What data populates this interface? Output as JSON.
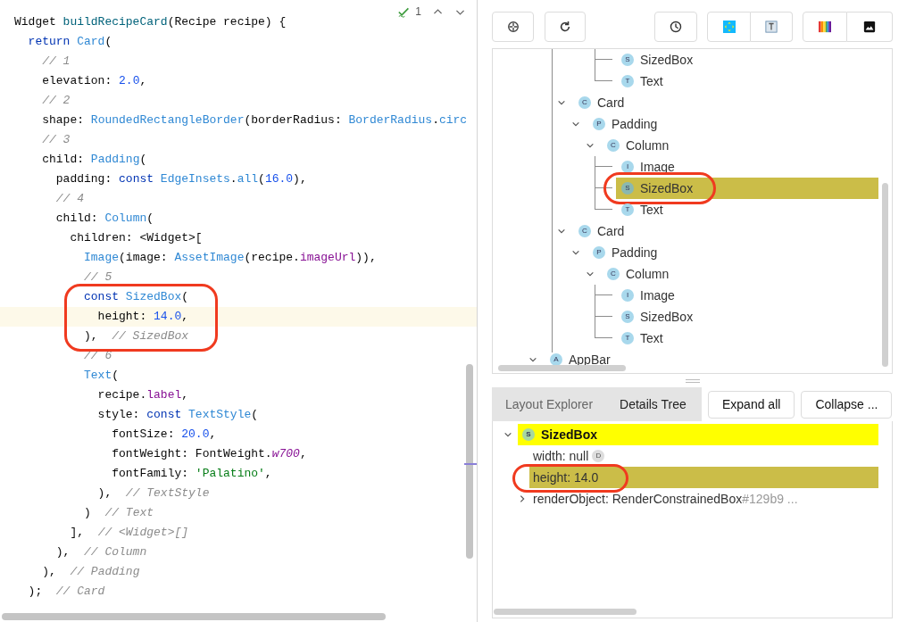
{
  "editor": {
    "inspection_count": "1",
    "lines": [
      {
        "current": false,
        "circled": false,
        "tokens": [
          {
            "text": "Widget ",
            "kind": "plain"
          },
          {
            "text": "buildRecipeCard",
            "kind": "function"
          },
          {
            "text": "(Recipe recipe) {",
            "kind": "plain"
          }
        ]
      },
      {
        "current": false,
        "circled": false,
        "tokens": [
          {
            "text": "  return ",
            "kind": "keyword"
          },
          {
            "text": "Card",
            "kind": "class"
          },
          {
            "text": "(",
            "kind": "plain"
          }
        ]
      },
      {
        "current": false,
        "circled": false,
        "tokens": [
          {
            "text": "    // 1",
            "kind": "comment"
          }
        ]
      },
      {
        "current": false,
        "circled": false,
        "tokens": [
          {
            "text": "    elevation: ",
            "kind": "plain"
          },
          {
            "text": "2.0",
            "kind": "number"
          },
          {
            "text": ",",
            "kind": "plain"
          }
        ]
      },
      {
        "current": false,
        "circled": false,
        "tokens": [
          {
            "text": "    // 2",
            "kind": "comment"
          }
        ]
      },
      {
        "current": false,
        "circled": false,
        "tokens": [
          {
            "text": "    shape: ",
            "kind": "plain"
          },
          {
            "text": "RoundedRectangleBorder",
            "kind": "class"
          },
          {
            "text": "(borderRadius: ",
            "kind": "plain"
          },
          {
            "text": "BorderRadius",
            "kind": "class"
          },
          {
            "text": ".",
            "kind": "plain"
          },
          {
            "text": "circ",
            "kind": "class"
          }
        ]
      },
      {
        "current": false,
        "circled": false,
        "tokens": [
          {
            "text": "    // 3",
            "kind": "comment"
          }
        ]
      },
      {
        "current": false,
        "circled": false,
        "tokens": [
          {
            "text": "    child: ",
            "kind": "plain"
          },
          {
            "text": "Padding",
            "kind": "class"
          },
          {
            "text": "(",
            "kind": "plain"
          }
        ]
      },
      {
        "current": false,
        "circled": false,
        "tokens": [
          {
            "text": "      padding: ",
            "kind": "plain"
          },
          {
            "text": "const ",
            "kind": "keyword"
          },
          {
            "text": "EdgeInsets",
            "kind": "class"
          },
          {
            "text": ".",
            "kind": "plain"
          },
          {
            "text": "all",
            "kind": "class"
          },
          {
            "text": "(",
            "kind": "plain"
          },
          {
            "text": "16.0",
            "kind": "number"
          },
          {
            "text": "),",
            "kind": "plain"
          }
        ]
      },
      {
        "current": false,
        "circled": false,
        "tokens": [
          {
            "text": "      // 4",
            "kind": "comment"
          }
        ]
      },
      {
        "current": false,
        "circled": false,
        "tokens": [
          {
            "text": "      child: ",
            "kind": "plain"
          },
          {
            "text": "Column",
            "kind": "class"
          },
          {
            "text": "(",
            "kind": "plain"
          }
        ]
      },
      {
        "current": false,
        "circled": false,
        "tokens": [
          {
            "text": "        children: <Widget>[",
            "kind": "plain"
          }
        ]
      },
      {
        "current": false,
        "circled": false,
        "tokens": [
          {
            "text": "          Image",
            "kind": "class"
          },
          {
            "text": "(image: ",
            "kind": "plain"
          },
          {
            "text": "AssetImage",
            "kind": "class"
          },
          {
            "text": "(recipe.",
            "kind": "plain"
          },
          {
            "text": "imageUrl",
            "kind": "field"
          },
          {
            "text": ")),",
            "kind": "plain"
          }
        ]
      },
      {
        "current": false,
        "circled": false,
        "tokens": [
          {
            "text": "          // 5",
            "kind": "comment"
          }
        ]
      },
      {
        "current": false,
        "circled": true,
        "tokens": [
          {
            "text": "          const ",
            "kind": "keyword"
          },
          {
            "text": "SizedBox",
            "kind": "class"
          },
          {
            "text": "(",
            "kind": "plain"
          }
        ]
      },
      {
        "current": true,
        "circled": true,
        "tokens": [
          {
            "text": "            height: ",
            "kind": "plain"
          },
          {
            "text": "14.0",
            "kind": "number"
          },
          {
            "text": ",",
            "kind": "plain"
          }
        ]
      },
      {
        "current": false,
        "circled": true,
        "tokens": [
          {
            "text": "          ),  ",
            "kind": "plain"
          },
          {
            "text": "// SizedBox",
            "kind": "comment"
          }
        ]
      },
      {
        "current": false,
        "circled": false,
        "tokens": [
          {
            "text": "          // 6",
            "kind": "comment"
          }
        ]
      },
      {
        "current": false,
        "circled": false,
        "tokens": [
          {
            "text": "          Text",
            "kind": "class"
          },
          {
            "text": "(",
            "kind": "plain"
          }
        ]
      },
      {
        "current": false,
        "circled": false,
        "tokens": [
          {
            "text": "            recipe.",
            "kind": "plain"
          },
          {
            "text": "label",
            "kind": "field"
          },
          {
            "text": ",",
            "kind": "plain"
          }
        ]
      },
      {
        "current": false,
        "circled": false,
        "tokens": [
          {
            "text": "            style: ",
            "kind": "plain"
          },
          {
            "text": "const ",
            "kind": "keyword"
          },
          {
            "text": "TextStyle",
            "kind": "class"
          },
          {
            "text": "(",
            "kind": "plain"
          }
        ]
      },
      {
        "current": false,
        "circled": false,
        "tokens": [
          {
            "text": "              fontSize: ",
            "kind": "plain"
          },
          {
            "text": "20.0",
            "kind": "number"
          },
          {
            "text": ",",
            "kind": "plain"
          }
        ]
      },
      {
        "current": false,
        "circled": false,
        "tokens": [
          {
            "text": "              fontWeight: FontWeight.",
            "kind": "plain"
          },
          {
            "text": "w700",
            "kind": "constant"
          },
          {
            "text": ",",
            "kind": "plain"
          }
        ]
      },
      {
        "current": false,
        "circled": false,
        "tokens": [
          {
            "text": "              fontFamily: ",
            "kind": "plain"
          },
          {
            "text": "'Palatino'",
            "kind": "string"
          },
          {
            "text": ",",
            "kind": "plain"
          }
        ]
      },
      {
        "current": false,
        "circled": false,
        "tokens": [
          {
            "text": "            ),  ",
            "kind": "plain"
          },
          {
            "text": "// TextStyle",
            "kind": "comment"
          }
        ]
      },
      {
        "current": false,
        "circled": false,
        "tokens": [
          {
            "text": "          )  ",
            "kind": "plain"
          },
          {
            "text": "// Text",
            "kind": "comment"
          }
        ]
      },
      {
        "current": false,
        "circled": false,
        "tokens": [
          {
            "text": "        ],  ",
            "kind": "plain"
          },
          {
            "text": "// <Widget>[]",
            "kind": "comment"
          }
        ]
      },
      {
        "current": false,
        "circled": false,
        "tokens": [
          {
            "text": "      ),  ",
            "kind": "plain"
          },
          {
            "text": "// Column",
            "kind": "comment"
          }
        ]
      },
      {
        "current": false,
        "circled": false,
        "tokens": [
          {
            "text": "    ),  ",
            "kind": "plain"
          },
          {
            "text": "// Padding",
            "kind": "comment"
          }
        ]
      },
      {
        "current": false,
        "circled": false,
        "tokens": [
          {
            "text": "  );  ",
            "kind": "plain"
          },
          {
            "text": "// Card",
            "kind": "comment"
          }
        ]
      }
    ]
  },
  "widget_tree": {
    "items": [
      {
        "children": [
          {
            "children": [
              {
                "children": [
                  {
                    "children": [
                      {
                        "children": [
                          {
                            "badge": "S",
                            "label": "SizedBox",
                            "selected": false,
                            "circled": false
                          },
                          {
                            "badge": "T",
                            "label": "Text",
                            "selected": false,
                            "circled": false
                          }
                        ]
                      }
                    ]
                  }
                ]
              },
              {
                "badge": "C",
                "label": "Card",
                "expanded": true,
                "selected": false,
                "circled": false,
                "children": [
                  {
                    "badge": "P",
                    "label": "Padding",
                    "expanded": true,
                    "selected": false,
                    "circled": false,
                    "children": [
                      {
                        "badge": "C",
                        "label": "Column",
                        "expanded": true,
                        "selected": false,
                        "circled": false,
                        "children": [
                          {
                            "badge": "I",
                            "label": "Image",
                            "selected": false,
                            "circled": false
                          },
                          {
                            "badge": "S",
                            "label": "SizedBox",
                            "selected": true,
                            "circled": true
                          },
                          {
                            "badge": "T",
                            "label": "Text",
                            "selected": false,
                            "circled": false
                          }
                        ]
                      }
                    ]
                  }
                ]
              },
              {
                "badge": "C",
                "label": "Card",
                "expanded": true,
                "selected": false,
                "circled": false,
                "children": [
                  {
                    "badge": "P",
                    "label": "Padding",
                    "expanded": true,
                    "selected": false,
                    "circled": false,
                    "children": [
                      {
                        "badge": "C",
                        "label": "Column",
                        "expanded": true,
                        "selected": false,
                        "circled": false,
                        "children": [
                          {
                            "badge": "I",
                            "label": "Image",
                            "selected": false,
                            "circled": false
                          },
                          {
                            "badge": "S",
                            "label": "SizedBox",
                            "selected": false,
                            "circled": false
                          },
                          {
                            "badge": "T",
                            "label": "Text",
                            "selected": false,
                            "circled": false
                          }
                        ]
                      }
                    ]
                  }
                ]
              }
            ]
          }
        ]
      },
      {
        "badge": "A",
        "label": "AppBar",
        "expanded": true,
        "selected": false,
        "circled": false
      }
    ]
  },
  "details": {
    "tabs": [
      {
        "label": "Layout Explorer",
        "selected": false
      },
      {
        "label": "Details Tree",
        "selected": true
      }
    ],
    "buttons": [
      "Expand all",
      "Collapse ..."
    ],
    "header": {
      "badge": "S",
      "label": "SizedBox",
      "expanded": true,
      "selected": true
    },
    "properties": [
      {
        "kind": "property",
        "text": "width: null",
        "badge": "D",
        "selected": false,
        "circled": false
      },
      {
        "kind": "property",
        "text": "height: 14.0",
        "selected": true,
        "circled": true
      },
      {
        "kind": "object",
        "text": "renderObject: RenderConstrainedBox",
        "suffix": "#129b9 ...",
        "expanded": false
      }
    ]
  }
}
